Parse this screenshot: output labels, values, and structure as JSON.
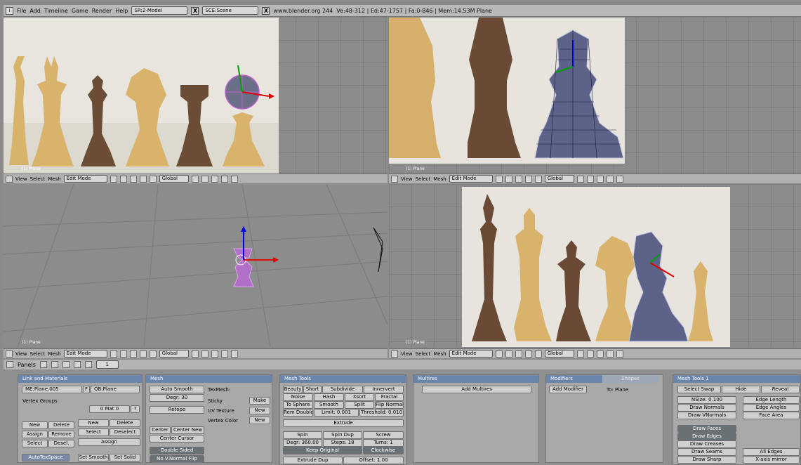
{
  "topbar": {
    "menus": [
      "File",
      "Add",
      "Timeline",
      "Game",
      "Render",
      "Help"
    ],
    "screen": "SR:2-Model",
    "scene": "SCE:Scene",
    "website": "www.blender.org 244",
    "stats": "Ve:48-312 | Ed:47-1757 | Fa:0-846 | Mem:14.53M Plane"
  },
  "viewport": {
    "label": "(1) Plane",
    "menus": [
      "View",
      "Select",
      "Mesh"
    ],
    "mode": "Edit Mode",
    "orientation": "Global"
  },
  "panels_header": {
    "label": "Panels",
    "frame": "1"
  },
  "link_materials": {
    "title": "Link and Materials",
    "me": "ME:Plane.005",
    "f": "F",
    "ob": "OB:Plane",
    "vertex_groups": "Vertex Groups",
    "mat": "0 Mat 0",
    "q": "?",
    "vg_buttons": [
      "New",
      "Delete",
      "Assign",
      "Remove",
      "Select",
      "Desel."
    ],
    "mat_buttons": [
      "New",
      "Delete",
      "Select",
      "Deselect",
      "Assign"
    ],
    "autotex": "AutoTexSpace",
    "set_smooth": "Set Smooth",
    "set_solid": "Set Solid"
  },
  "mesh": {
    "title": "Mesh",
    "auto_smooth": "Auto Smooth",
    "degr": "Degr: 30",
    "retopo": "Retopo",
    "center": "Center",
    "center_new": "Center New",
    "center_cursor": "Center Cursor",
    "double_sided": "Double Sided",
    "no_vnormal_flip": "No V.Normal Flip",
    "texmesh": "TexMesh:",
    "sticky": "Sticky",
    "uv_texture": "UV Texture",
    "vertex_color": "Vertex Color",
    "make": "Make",
    "new1": "New",
    "new2": "New"
  },
  "mesh_tools": {
    "title": "Mesh Tools",
    "row1": [
      "Beauty",
      "Short",
      "Subdivide",
      "Innervert"
    ],
    "row2": [
      "Noise",
      "Hash",
      "Xsort",
      "Fractal"
    ],
    "row3": [
      "To Sphere",
      "Smooth",
      "Split",
      "Flip Normals"
    ],
    "row4": [
      "Rem Double",
      "Limit: 0.001",
      "Threshold: 0.010"
    ],
    "extrude": "Extrude",
    "row6": [
      "Spin",
      "Spin Dup",
      "Screw"
    ],
    "row7": [
      "Degr: 360.00",
      "Steps: 18",
      "Turns: 1"
    ],
    "keep_original": "Keep Original",
    "clockwise": "Clockwise",
    "extrude_dup": "Extrude Dup",
    "offset": "Offset: 1.00"
  },
  "multires": {
    "title": "Multires",
    "add": "Add Multires"
  },
  "modifiers": {
    "tab1": "Modifiers",
    "tab2": "Shapes",
    "add": "Add Modifier",
    "to": "To: Plane"
  },
  "mesh_tools1": {
    "title": "Mesh Tools 1",
    "select_swap": "Select Swap",
    "hide": "Hide",
    "reveal": "Reveal",
    "nsize": "NSize: 0.100",
    "draw_normals": "Draw Normals",
    "draw_vnormals": "Draw VNormals",
    "edge_length": "Edge Length",
    "edge_angles": "Edge Angles",
    "face_area": "Face Area",
    "draw_faces": "Draw Faces",
    "draw_edges": "Draw Edges",
    "draw_creases": "Draw Creases",
    "draw_seams": "Draw Seams",
    "draw_sharp": "Draw Sharp",
    "all_edges": "All Edges",
    "x_mirror": "X-axis mirror"
  },
  "colors": {
    "panel_title": "#6a85ab",
    "active_button": "#6a7175",
    "background": "#8a8a8a"
  }
}
